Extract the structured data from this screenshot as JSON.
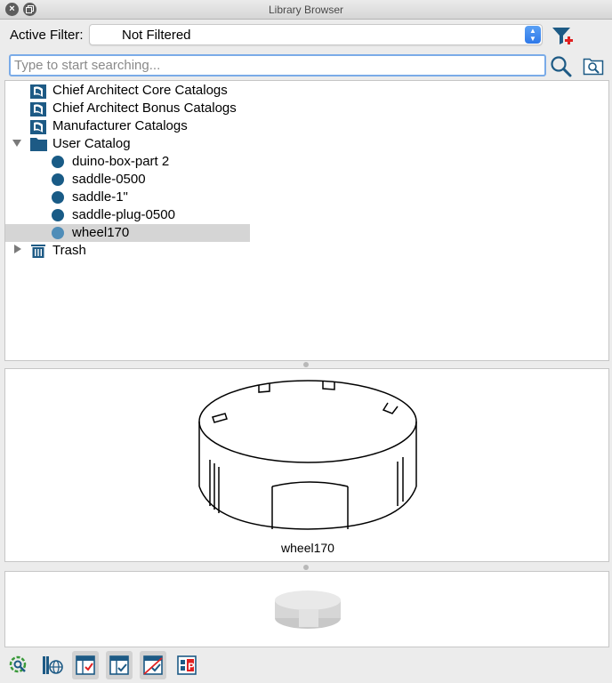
{
  "window": {
    "title": "Library Browser"
  },
  "filter": {
    "label": "Active Filter:",
    "value": "Not Filtered"
  },
  "search": {
    "placeholder": "Type to start searching..."
  },
  "tree": {
    "core": "Chief Architect Core Catalogs",
    "bonus": "Chief Architect Bonus Catalogs",
    "manufacturer": "Manufacturer Catalogs",
    "user_catalog": "User Catalog",
    "items": [
      "duino-box-part 2",
      "saddle-0500",
      "saddle-1\"",
      "saddle-plug-0500",
      "wheel170"
    ],
    "selected_item": "wheel170",
    "trash": "Trash"
  },
  "preview": {
    "name": "wheel170"
  },
  "colors": {
    "accent": "#2e78e8",
    "folder": "#1d5a85",
    "selection": "#d5d5d5"
  },
  "toolbar": {
    "icons": [
      "library-search-icon",
      "globe-catalog-icon",
      "view-mode-1-icon",
      "view-mode-2-icon",
      "view-mode-3-icon",
      "properties-icon"
    ]
  }
}
